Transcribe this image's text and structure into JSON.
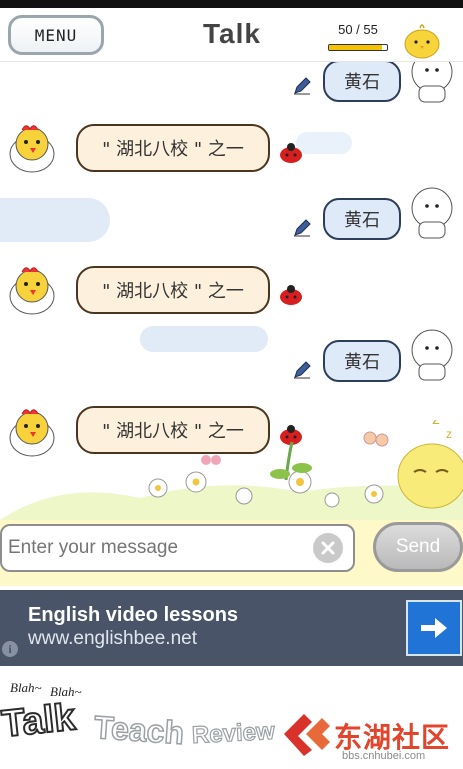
{
  "header": {
    "menu_label": "MENU",
    "title": "Talk",
    "count_text": "50 / 55",
    "count_fraction": 0.91
  },
  "messages": [
    {
      "side": "right",
      "text": "黄石"
    },
    {
      "side": "left",
      "text": "\" 湖北八校 \" 之一"
    },
    {
      "side": "right",
      "text": "黄石"
    },
    {
      "side": "left",
      "text": "\" 湖北八校 \" 之一"
    },
    {
      "side": "right",
      "text": "黄石"
    },
    {
      "side": "left",
      "text": "\" 湖北八校 \" 之一"
    }
  ],
  "composer": {
    "placeholder": "Enter your message",
    "send_label": "Send"
  },
  "ad": {
    "headline": "English video lessons",
    "url": "www.englishbee.net",
    "info_glyph": "i"
  },
  "tabs": {
    "blah1": "Blah~",
    "blah2": "Blah~",
    "talk": "Talk",
    "teach": "Teach",
    "review": "Review"
  },
  "watermark": {
    "name": "东湖社区",
    "url": "bbs.cnhubei.com"
  },
  "colors": {
    "accent_blue": "#1f74d6",
    "composer_bg": "#fff9c9",
    "ad_bg": "#4a5469"
  }
}
